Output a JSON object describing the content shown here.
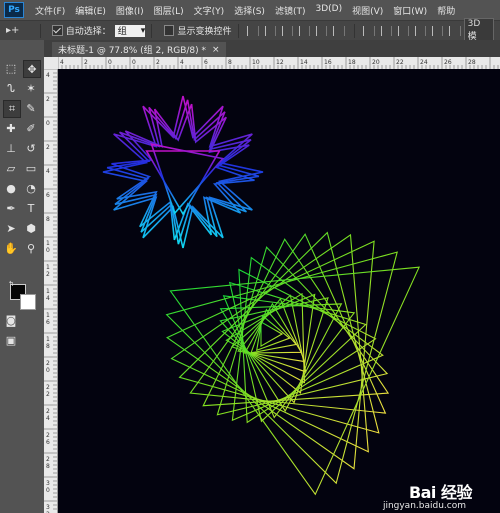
{
  "app": {
    "logo": "Ps"
  },
  "menu": [
    "文件(F)",
    "编辑(E)",
    "图像(I)",
    "图层(L)",
    "文字(Y)",
    "选择(S)",
    "滤镜(T)",
    "3D(D)",
    "视图(V)",
    "窗口(W)",
    "帮助"
  ],
  "options": {
    "tool_glyph": "▸+",
    "auto_select_label": "自动选择：",
    "auto_select_value": "组",
    "show_transform_label": "显示变换控件",
    "mode_label": "3D 模"
  },
  "document_tab": {
    "title": "未标题-1 @ 77.8% (组 2, RGB/8) *",
    "close": "×"
  },
  "ruler_top_labels": [
    "4",
    "2",
    "0",
    "0",
    "2",
    "4",
    "6",
    "8",
    "1\n0",
    "1\n2",
    "1\n4",
    "1\n6",
    "1\n8",
    "2\n0",
    "2\n2",
    "2\n4",
    "2\n6",
    "2\n8"
  ],
  "ruler_left_labels": [
    "4",
    "2",
    "0",
    "2",
    "4",
    "6",
    "8",
    "1\n0",
    "1\n2",
    "1\n4",
    "1\n6",
    "1\n8",
    "2\n0",
    "2\n2",
    "2\n4",
    "2\n6",
    "2\n8",
    "3\n0",
    "3\n2"
  ],
  "colors": {
    "fg": "#050505",
    "bg": "#ffffff",
    "canvas": "#03030f"
  },
  "watermark": {
    "logo": "Bai 经验",
    "url": "jingyan.baidu.com"
  }
}
